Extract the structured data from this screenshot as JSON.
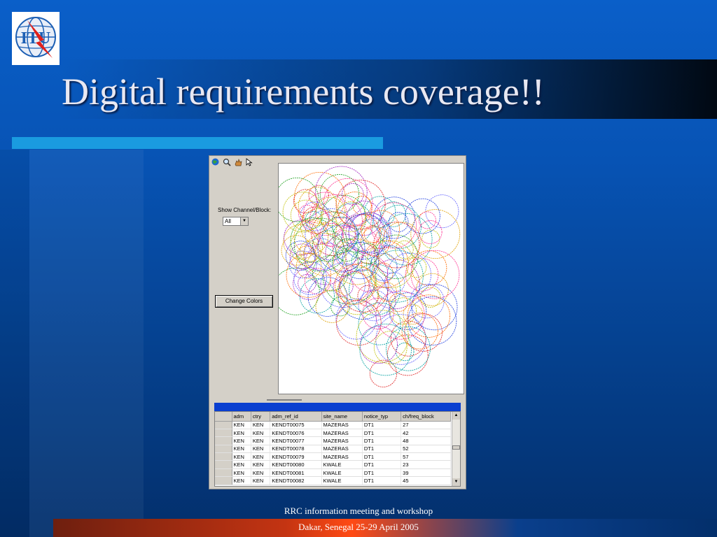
{
  "slide": {
    "title": "Digital requirements coverage!!",
    "footer_line1": "RRC information meeting and workshop",
    "footer_line2": "Dakar, Senegal 25-29 April 2005",
    "logo_text": "ITU"
  },
  "app": {
    "toolbar_icons": [
      "globe-icon",
      "zoom-icon",
      "pan-icon",
      "pointer-icon"
    ],
    "channel_label": "Show Channel/Block:",
    "channel_value": "All",
    "change_colors_label": "Change Colors",
    "grid": {
      "columns": [
        "adm",
        "ctry",
        "adm_ref_id",
        "site_name",
        "notice_typ",
        "ch/freq_block"
      ],
      "rows": [
        [
          "KEN",
          "KEN",
          "KENDT00075",
          "MAZERAS",
          "DT1",
          "27"
        ],
        [
          "KEN",
          "KEN",
          "KENDT00076",
          "MAZERAS",
          "DT1",
          "42"
        ],
        [
          "KEN",
          "KEN",
          "KENDT00077",
          "MAZERAS",
          "DT1",
          "48"
        ],
        [
          "KEN",
          "KEN",
          "KENDT00078",
          "MAZERAS",
          "DT1",
          "52"
        ],
        [
          "KEN",
          "KEN",
          "KENDT00079",
          "MAZERAS",
          "DT1",
          "57"
        ],
        [
          "KEN",
          "KEN",
          "KENDT00080",
          "KWALE",
          "DT1",
          "23"
        ],
        [
          "KEN",
          "KEN",
          "KENDT00081",
          "KWALE",
          "DT1",
          "39"
        ],
        [
          "KEN",
          "KEN",
          "KENDT00082",
          "KWALE",
          "DT1",
          "45"
        ]
      ]
    }
  },
  "colors": {
    "background": "#0753b4",
    "accent_bar": "#1a9be0",
    "grid_title_bar": "#0a3fd0"
  }
}
